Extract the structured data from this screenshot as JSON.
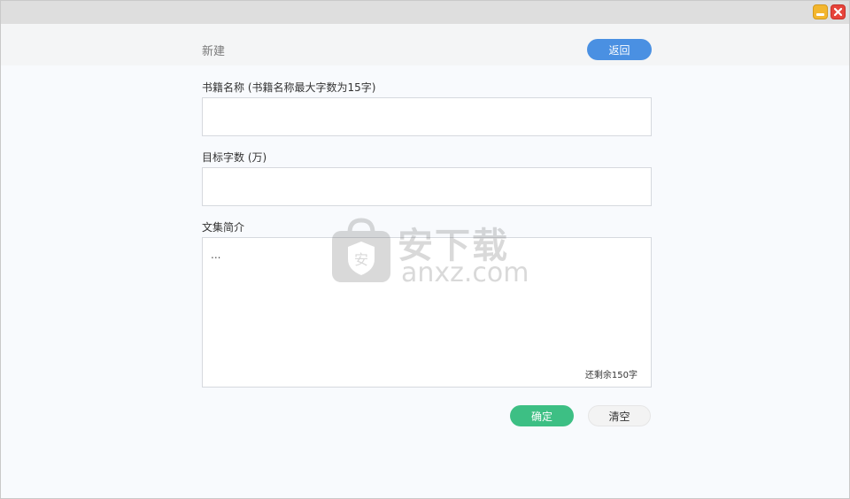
{
  "window": {
    "minimize_icon": "minimize-icon",
    "close_icon": "close-icon"
  },
  "header": {
    "title": "新建",
    "back_label": "返回"
  },
  "form": {
    "book_name_label": "书籍名称 (书籍名称最大字数为15字)",
    "book_name_value": "",
    "target_words_label": "目标字数 (万)",
    "target_words_value": "",
    "intro_label": "文集简介",
    "intro_placeholder": "...",
    "remaining_text": "还剩余150字"
  },
  "actions": {
    "confirm_label": "确定",
    "clear_label": "清空"
  },
  "watermark": {
    "cn": "安下载",
    "en": "anxz.com"
  },
  "colors": {
    "back_button": "#4a90e2",
    "confirm_button": "#3dbf84",
    "minimize": "#f3b62e",
    "close": "#e6433a"
  }
}
